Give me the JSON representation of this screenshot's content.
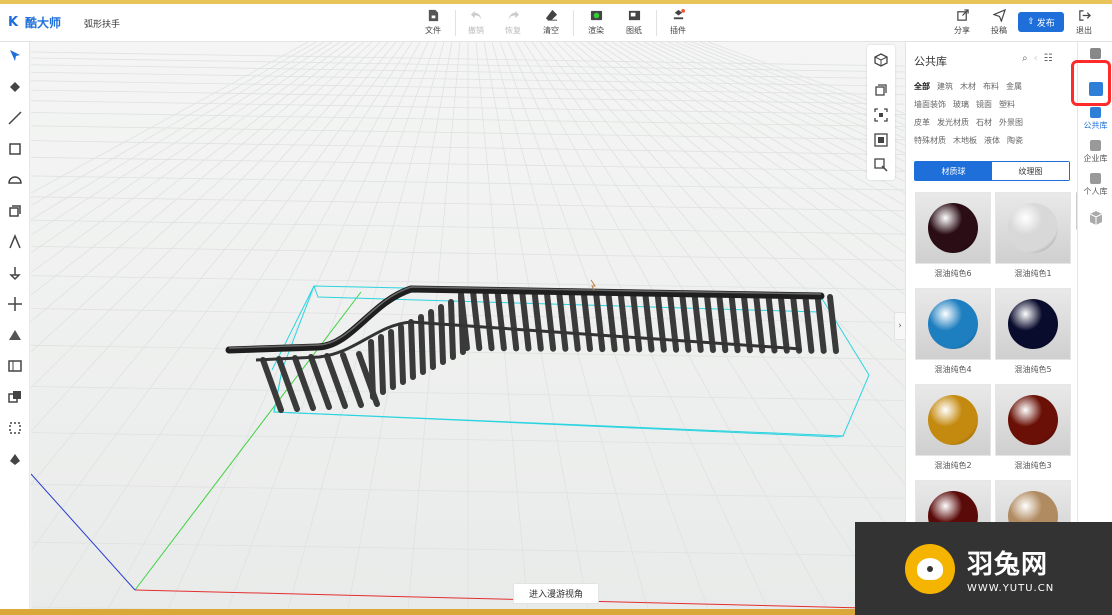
{
  "app": {
    "logo": "酷大师",
    "doc_title": "弧形扶手"
  },
  "toolbar": {
    "file": "文件",
    "undo": "撤销",
    "redo": "恢复",
    "clear": "清空",
    "render": "渲染",
    "drawing": "图纸",
    "plugin": "插件",
    "share": "分享",
    "submit": "投稿",
    "publish": "发布",
    "exit": "退出"
  },
  "viewport": {
    "roam_button": "进入漫游视角"
  },
  "library": {
    "title": "公共库",
    "categories": [
      [
        "全部",
        "建筑",
        "木材",
        "布料",
        "金属"
      ],
      [
        "墙面装饰",
        "玻璃",
        "镜面",
        "塑料"
      ],
      [
        "皮革",
        "发光材质",
        "石材",
        "外景图"
      ],
      [
        "特殊材质",
        "木地板",
        "液体",
        "陶瓷"
      ]
    ],
    "tabs": {
      "material_ball": "材质球",
      "texture": "纹理图"
    },
    "materials": [
      {
        "name": "混油纯色6",
        "color": "#2a0d15"
      },
      {
        "name": "混油纯色1",
        "color": "#d8d8d8"
      },
      {
        "name": "混油纯色4",
        "color": "#1e7fc0"
      },
      {
        "name": "混油纯色5",
        "color": "#0a0c2e"
      },
      {
        "name": "混油纯色2",
        "color": "#c48a10"
      },
      {
        "name": "混油纯色3",
        "color": "#6a1006"
      },
      {
        "name": "",
        "color": "#5a0a08"
      },
      {
        "name": "",
        "color": "#b08a60"
      }
    ]
  },
  "right_tabs": {
    "public": "公共库",
    "enterprise": "企业库",
    "personal": "个人库"
  },
  "watermark": {
    "cn": "羽兔网",
    "url": "WWW.YUTU.CN"
  }
}
